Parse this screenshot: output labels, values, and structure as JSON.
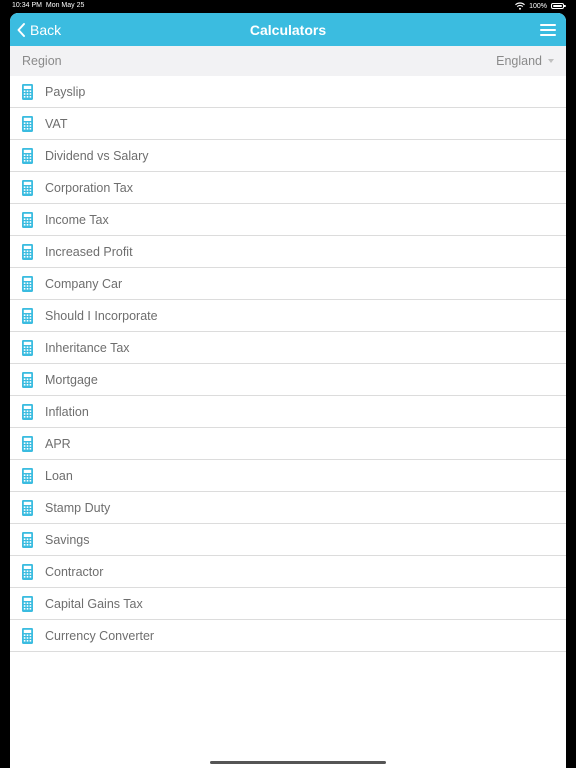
{
  "status_bar": {
    "time": "10:34 PM",
    "date": "Mon May 25",
    "battery": "100%"
  },
  "nav": {
    "back_label": "Back",
    "title": "Calculators",
    "accent_color": "#3bbce0"
  },
  "region": {
    "label": "Region",
    "value": "England"
  },
  "calculators": [
    "Payslip",
    "VAT",
    "Dividend vs Salary",
    "Corporation Tax",
    "Income Tax",
    "Increased Profit",
    "Company Car",
    "Should I Incorporate",
    "Inheritance Tax",
    "Mortgage",
    "Inflation",
    "APR",
    "Loan",
    "Stamp Duty",
    "Savings",
    "Contractor",
    "Capital Gains Tax",
    "Currency Converter"
  ]
}
